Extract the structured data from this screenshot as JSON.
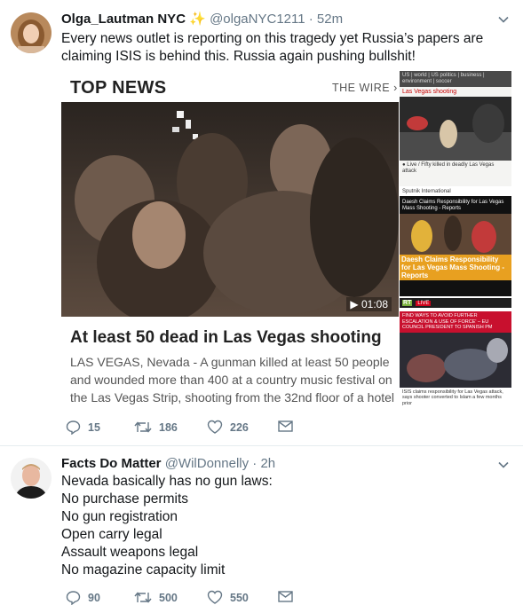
{
  "tweets": [
    {
      "name": "Olga_Lautman NYC",
      "badge": "✨",
      "handle": "@olgaNYC1211",
      "time": "· 52m",
      "text": "Every news outlet is reporting on this tragedy yet Russia’s papers are claiming ISIS is behind this. Russia again pushing bullshit!",
      "card": {
        "section_title": "TOP NEWS",
        "wire_link": "THE WIRE",
        "video_duration": "01:08",
        "headline": "At least 50 dead in Las Vegas shooting",
        "summary": "LAS VEGAS, Nevada - A gunman killed at least 50 people and wounded more than 400 at a country music festival on the Las Vegas Strip, shooting from the 32nd floor of a hotel",
        "side1_nav": "US | world | US politics | business | environment | soccer",
        "side1_section": "Las Vegas shooting",
        "side1_caption": "● Live / Fifty killed in deadly Las Vegas attack",
        "side2_nav": "Sputnik International",
        "side2_top": "Daesh Claims Responsibility for Las Vegas Mass Shooting - Reports",
        "side2_caption": "Daesh Claims Responsibility for Las Vegas Mass Shooting - Reports",
        "side3_logo": "RT",
        "side3_live": "LIVE",
        "side3_banner": "FIND WAYS TO AVOID FURTHER ESCALATION & USE OF FORCE' – EU COUNCIL PRESIDENT TO SPANISH PM",
        "side3_caption": "ISIS claims responsibility for Las Vegas attack, says shooter converted to Islam a few months prior"
      },
      "actions": {
        "replies": "15",
        "retweets": "186",
        "likes": "226"
      }
    },
    {
      "name": "Facts Do Matter",
      "handle": "@WilDonnelly",
      "time": "· 2h",
      "lines": [
        "Nevada basically has no gun laws:",
        "No purchase permits",
        "No gun registration",
        "Open carry legal",
        "Assault weapons legal",
        "No magazine capacity limit"
      ],
      "actions": {
        "replies": "90",
        "retweets": "500",
        "likes": "550"
      }
    }
  ],
  "colors": {
    "muted": "#657786",
    "text": "#14171a",
    "divider": "#e6ecf0",
    "accent": "#e8a020"
  }
}
